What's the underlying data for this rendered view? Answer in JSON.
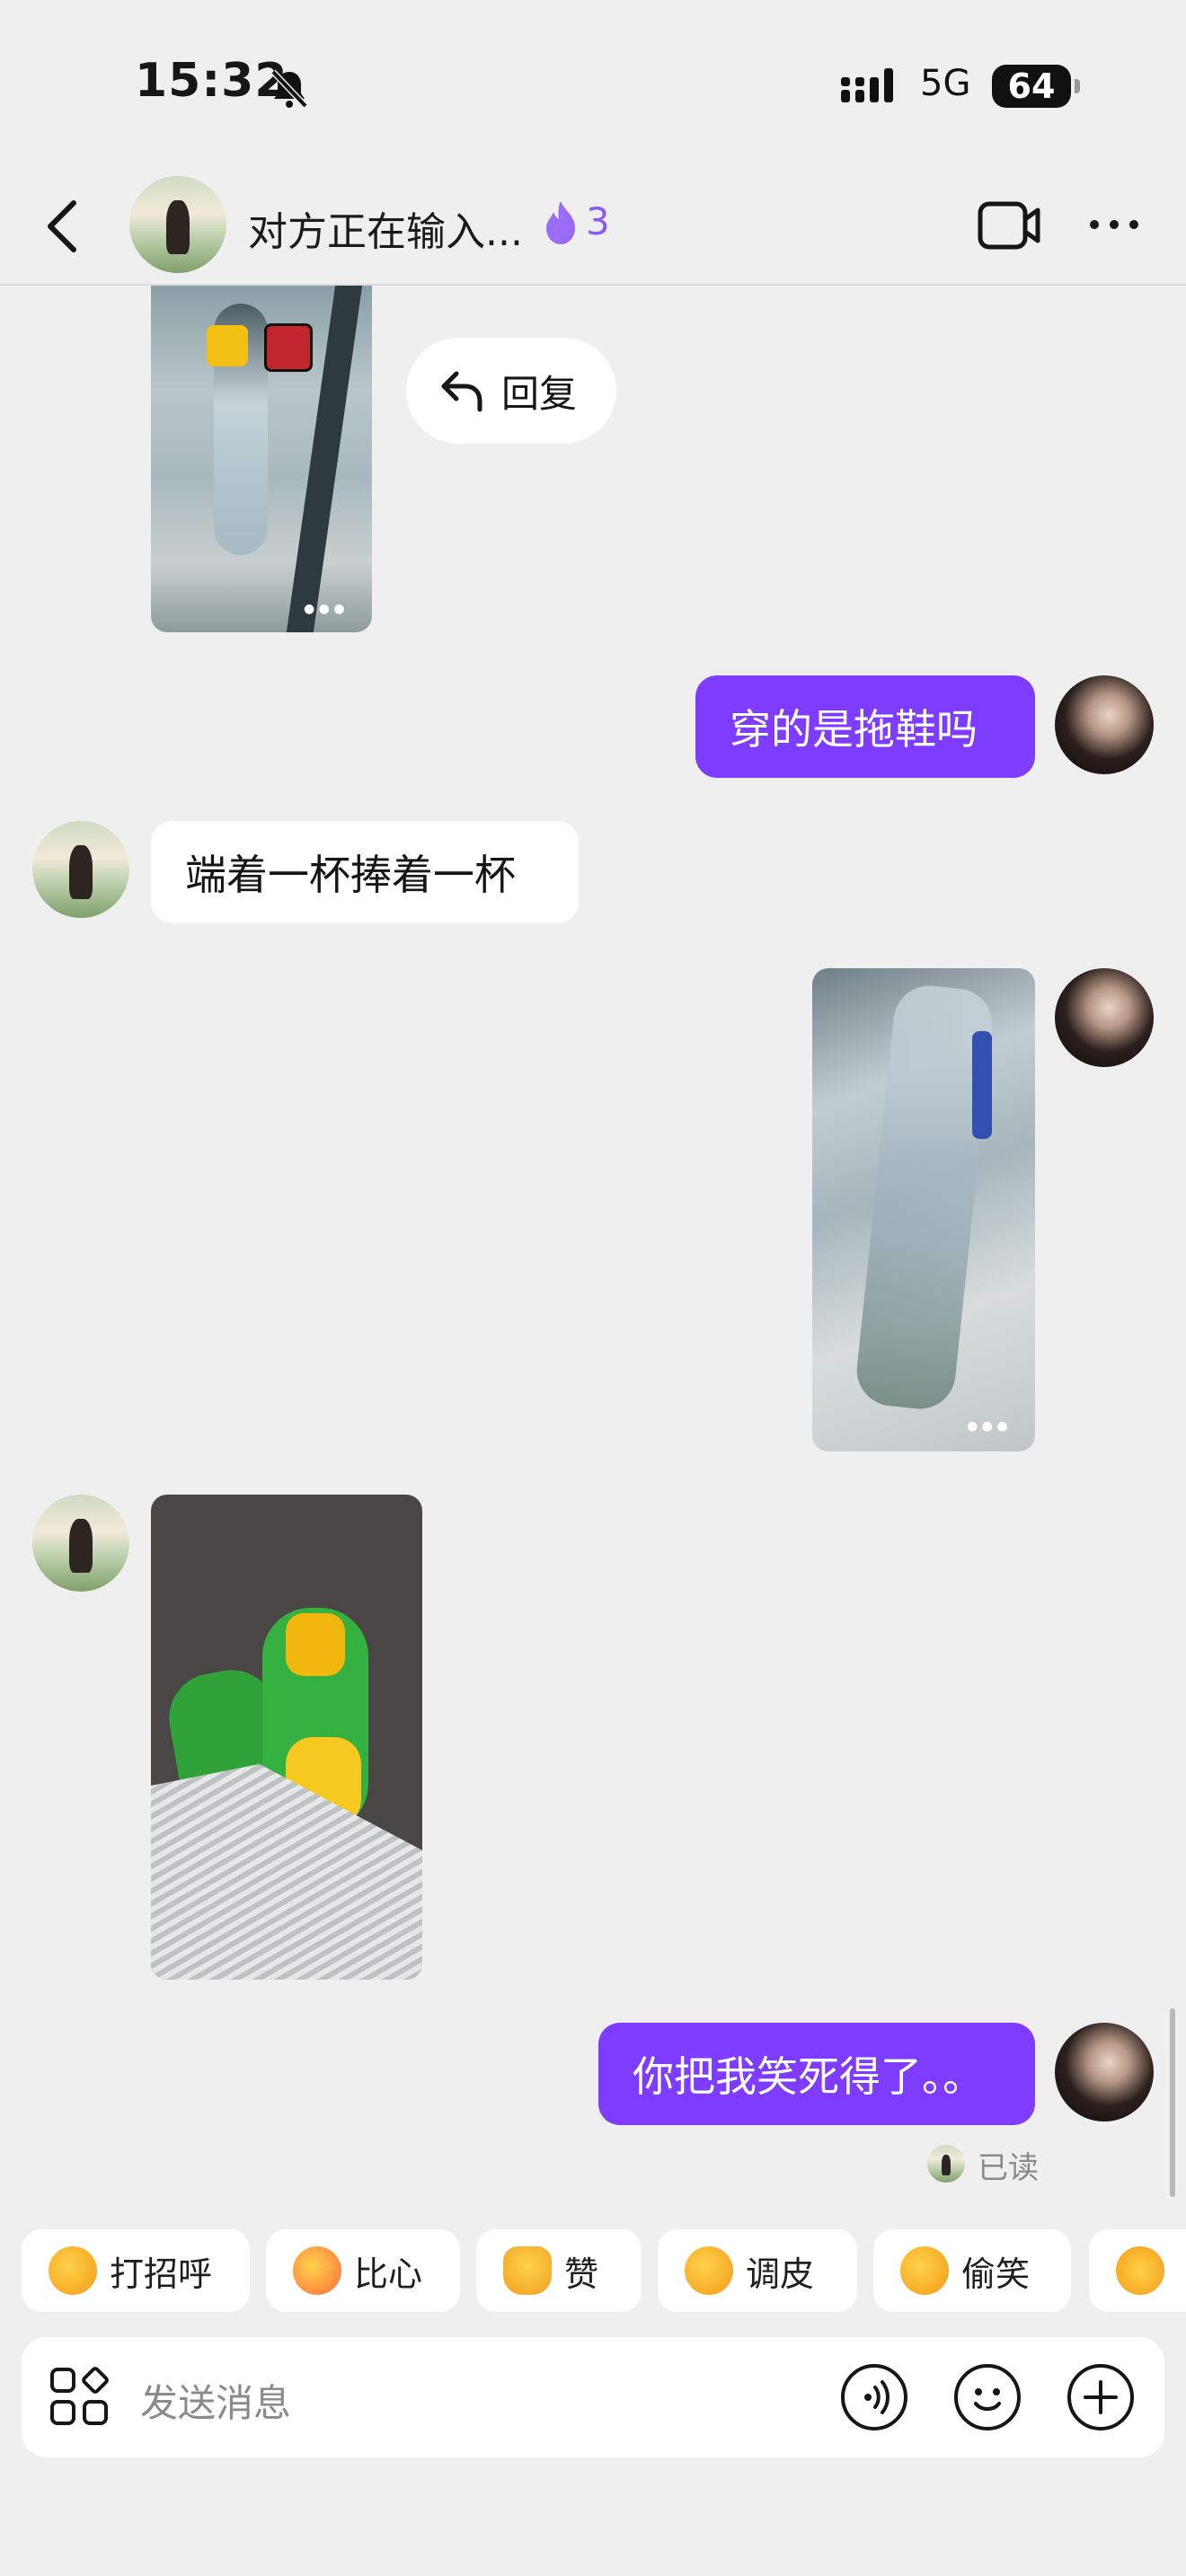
{
  "status_bar": {
    "time": "15:32",
    "network": "5G",
    "battery": "64"
  },
  "header": {
    "title": "对方正在输入...",
    "fire_count": "3"
  },
  "messages": {
    "reply_button": "回复",
    "m1": "穿的是拖鞋吗",
    "m2": "端着一杯捧着一杯",
    "m3": "你把我笑死得了。。",
    "read_status": "已读"
  },
  "quick_replies": [
    {
      "label": "打招呼",
      "icon": "smile-emoji-icon"
    },
    {
      "label": "比心",
      "icon": "heart-hands-emoji-icon"
    },
    {
      "label": "赞",
      "icon": "thumbs-up-emoji-icon"
    },
    {
      "label": "调皮",
      "icon": "wink-emoji-icon"
    },
    {
      "label": "偷笑",
      "icon": "giggle-emoji-icon"
    }
  ],
  "composer": {
    "placeholder": "发送消息"
  },
  "colors": {
    "accent": "#7d3cff",
    "background": "#efefef"
  }
}
